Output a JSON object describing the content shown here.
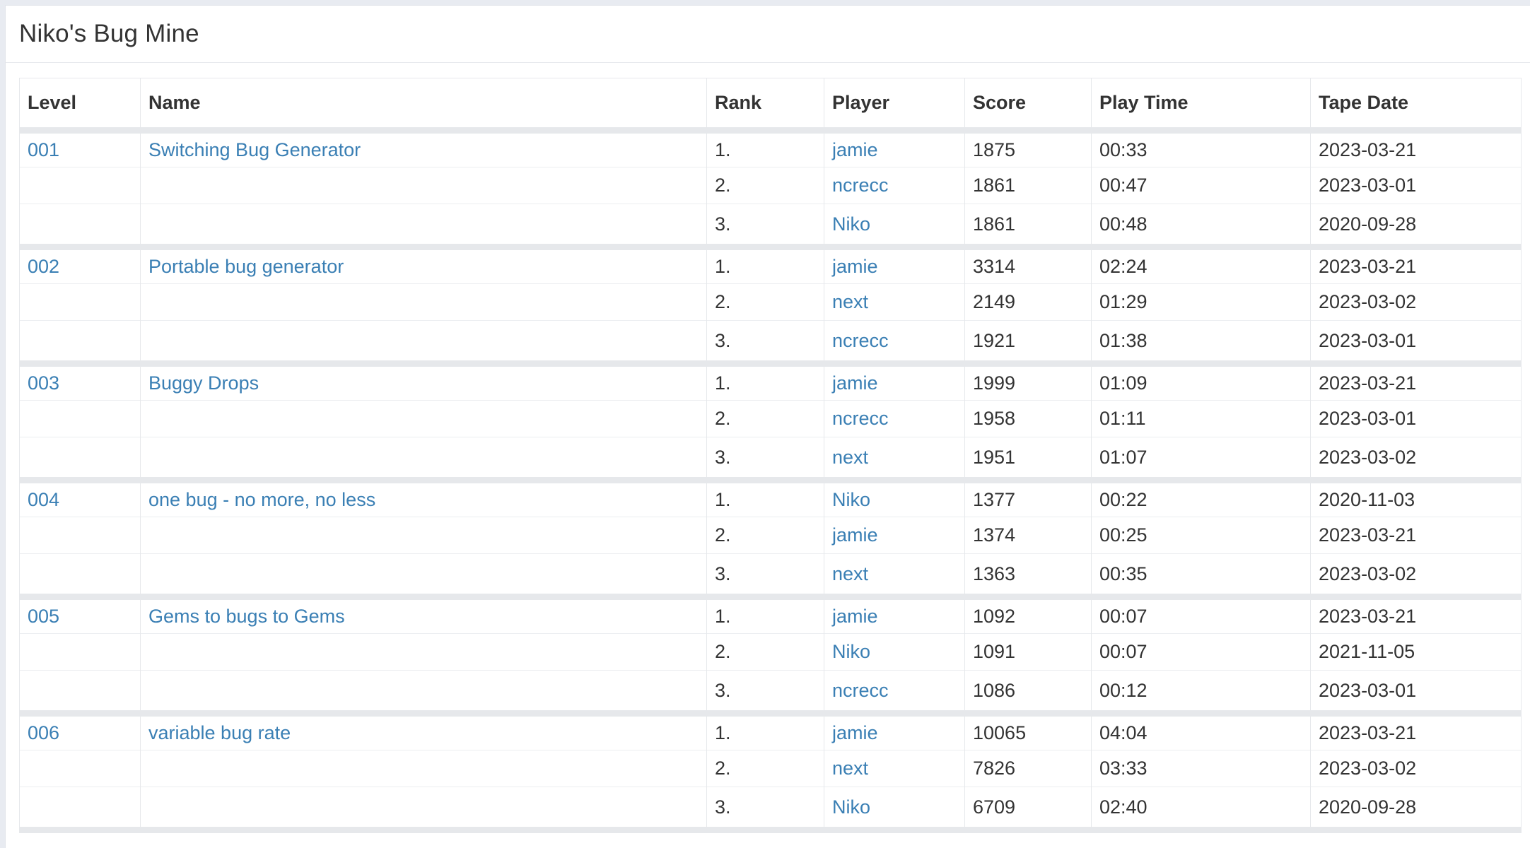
{
  "page": {
    "title": "Niko's Bug Mine"
  },
  "table": {
    "headers": [
      "Level",
      "Name",
      "Rank",
      "Player",
      "Score",
      "Play Time",
      "Tape Date"
    ],
    "levels": [
      {
        "level": "001",
        "name": "Switching Bug Generator",
        "entries": [
          {
            "rank": "1.",
            "player": "jamie",
            "score": "1875",
            "time": "00:33",
            "date": "2023-03-21"
          },
          {
            "rank": "2.",
            "player": "ncrecc",
            "score": "1861",
            "time": "00:47",
            "date": "2023-03-01"
          },
          {
            "rank": "3.",
            "player": "Niko",
            "score": "1861",
            "time": "00:48",
            "date": "2020-09-28"
          }
        ]
      },
      {
        "level": "002",
        "name": "Portable bug generator",
        "entries": [
          {
            "rank": "1.",
            "player": "jamie",
            "score": "3314",
            "time": "02:24",
            "date": "2023-03-21"
          },
          {
            "rank": "2.",
            "player": "next",
            "score": "2149",
            "time": "01:29",
            "date": "2023-03-02"
          },
          {
            "rank": "3.",
            "player": "ncrecc",
            "score": "1921",
            "time": "01:38",
            "date": "2023-03-01"
          }
        ]
      },
      {
        "level": "003",
        "name": "Buggy Drops",
        "entries": [
          {
            "rank": "1.",
            "player": "jamie",
            "score": "1999",
            "time": "01:09",
            "date": "2023-03-21"
          },
          {
            "rank": "2.",
            "player": "ncrecc",
            "score": "1958",
            "time": "01:11",
            "date": "2023-03-01"
          },
          {
            "rank": "3.",
            "player": "next",
            "score": "1951",
            "time": "01:07",
            "date": "2023-03-02"
          }
        ]
      },
      {
        "level": "004",
        "name": "one bug - no more, no less",
        "entries": [
          {
            "rank": "1.",
            "player": "Niko",
            "score": "1377",
            "time": "00:22",
            "date": "2020-11-03"
          },
          {
            "rank": "2.",
            "player": "jamie",
            "score": "1374",
            "time": "00:25",
            "date": "2023-03-21"
          },
          {
            "rank": "3.",
            "player": "next",
            "score": "1363",
            "time": "00:35",
            "date": "2023-03-02"
          }
        ]
      },
      {
        "level": "005",
        "name": "Gems to bugs to Gems",
        "entries": [
          {
            "rank": "1.",
            "player": "jamie",
            "score": "1092",
            "time": "00:07",
            "date": "2023-03-21"
          },
          {
            "rank": "2.",
            "player": "Niko",
            "score": "1091",
            "time": "00:07",
            "date": "2021-11-05"
          },
          {
            "rank": "3.",
            "player": "ncrecc",
            "score": "1086",
            "time": "00:12",
            "date": "2023-03-01"
          }
        ]
      },
      {
        "level": "006",
        "name": "variable bug rate",
        "entries": [
          {
            "rank": "1.",
            "player": "jamie",
            "score": "10065",
            "time": "04:04",
            "date": "2023-03-21"
          },
          {
            "rank": "2.",
            "player": "next",
            "score": "7826",
            "time": "03:33",
            "date": "2023-03-02"
          },
          {
            "rank": "3.",
            "player": "Niko",
            "score": "6709",
            "time": "02:40",
            "date": "2020-09-28"
          }
        ]
      }
    ]
  },
  "colors": {
    "link": "#3a7fb4",
    "text": "#333333",
    "divider": "#e6e8eb",
    "background": "#e8ebf1"
  }
}
